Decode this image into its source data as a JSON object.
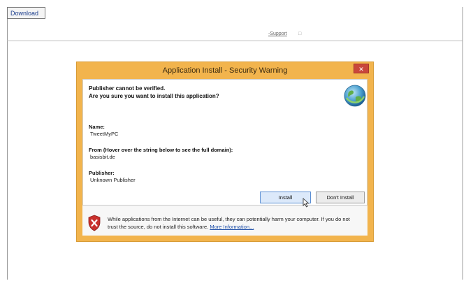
{
  "page": {
    "download_label": "Download",
    "support_label": "-Support",
    "support_sep": "□"
  },
  "dialog": {
    "title": "Application Install - Security Warning",
    "close_symbol": "✕",
    "headline_1": "Publisher cannot be verified.",
    "headline_2": "Are you sure you want to install this application?",
    "name_label": "Name:",
    "name_value": "TweetMyPC",
    "from_label": "From (Hover over the string below to see the full domain):",
    "from_value": "basisbit.de",
    "publisher_label": "Publisher:",
    "publisher_value": "Unknown Publisher",
    "install_label": "Install",
    "dont_install_label": "Don't Install",
    "warning_text": "While applications from the Internet can be useful, they can potentially harm your computer. If you do not trust the source, do not install this software.",
    "more_info_label": "More Information...",
    "icons": [
      "globe-icon",
      "shield-warning-icon",
      "mouse-cursor-icon"
    ],
    "colors": {
      "titlebar": "#f2b44d",
      "close": "#c9473b",
      "install_border": "#5b8fd3"
    }
  }
}
